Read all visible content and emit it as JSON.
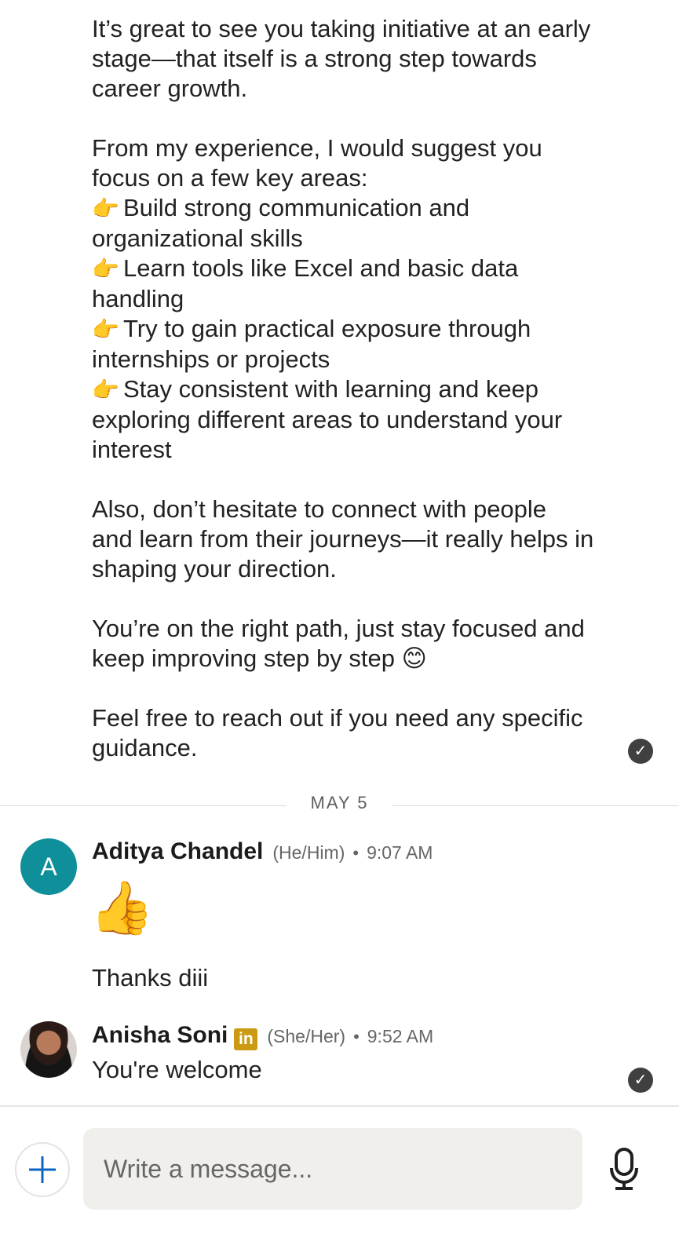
{
  "previous_message": {
    "paragraphs": [
      {
        "lines": [
          "It’s great to see you taking initiative at an early",
          "stage—that itself is a strong step towards",
          "career growth."
        ]
      },
      {
        "lines": [
          "From my experience, I would suggest you",
          "focus on a few key areas:"
        ]
      }
    ],
    "points": [
      {
        "icon": "👉",
        "line1": "Build strong communication and",
        "line2": "organizational skills"
      },
      {
        "icon": "👉",
        "line1": "Learn tools like Excel and basic data",
        "line2": "handling"
      },
      {
        "icon": "👉",
        "line1": "Try to gain practical exposure through",
        "line2": "internships or projects"
      },
      {
        "icon": "👉",
        "line1": "Stay consistent with learning and keep",
        "line2": "exploring different areas to understand your",
        "line3": "interest"
      }
    ],
    "closing": [
      {
        "lines": [
          "Also, don’t hesitate to connect with people",
          "and learn from their journeys—it really helps in",
          "shaping your direction."
        ]
      },
      {
        "lines": [
          "You’re on the right path, just stay focused and",
          "keep improving step by step 😊"
        ]
      },
      {
        "lines": [
          "Feel free to reach out if you need any specific",
          "guidance."
        ]
      }
    ],
    "read_icon": "check-circle-icon"
  },
  "date_separator": "MAY 5",
  "messages": [
    {
      "sender": "Aditya Chandel",
      "avatar_letter": "A",
      "avatar_color": "#0e8f9a",
      "pronouns": "(He/Him)",
      "dot": "•",
      "time": "9:07 AM",
      "emoji": "👍",
      "text": "Thanks diii"
    },
    {
      "sender": "Anisha Soni",
      "badge": "in",
      "pronouns": "(She/Her)",
      "dot": "•",
      "time": "9:52 AM",
      "text": "You're welcome",
      "read_icon": "check-circle-icon"
    }
  ],
  "composer": {
    "placeholder": "Write a message...",
    "add_icon": "plus-icon",
    "mic_icon": "microphone-icon"
  }
}
